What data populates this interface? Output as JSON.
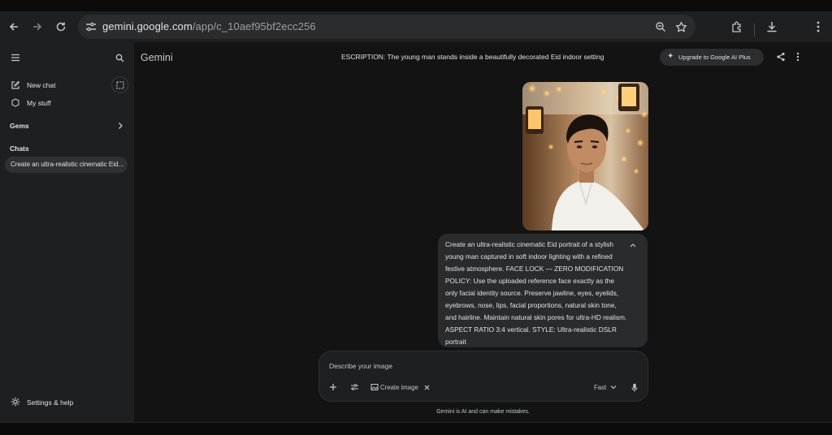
{
  "browser": {
    "url_host": "gemini.google.com",
    "url_path": "/app/c_10aef95bf2ecc256"
  },
  "sidebar": {
    "new_chat": "New chat",
    "my_stuff": "My stuff",
    "gems": "Gems",
    "chats_heading": "Chats",
    "chat_items": [
      "Create an ultra-realistic cinematic Eid..."
    ],
    "settings": "Settings & help"
  },
  "header": {
    "brand": "Gemini",
    "conversation_title": "ESCRIPTION: The young man stands inside a beautifully decorated Eid indoor setting",
    "upgrade_label": "Upgrade to Google AI Plus"
  },
  "message": {
    "text": "Create an ultra-realistic cinematic Eid portrait of a stylish young man captured in soft indoor lighting with a refined festive atmosphere. FACE LOCK — ZERO MODIFICATION POLICY: Use the uploaded reference face exactly as the only facial identity source. Preserve jawline, eyes, eyelids, eyebrows, nose, lips, facial proportions, natural skin tone, and hairline. Maintain natural skin pores for ultra-HD realism. ASPECT RATIO 3:4 vertical. STYLE: Ultra-realistic DSLR portrait"
  },
  "composer": {
    "placeholder": "Describe your image",
    "create_image_label": "Create image",
    "mode_label": "Fast"
  },
  "footer": {
    "disclaimer": "Gemini is AI and can make mistakes."
  },
  "colors": {
    "sidebar_bg": "#1e1f20",
    "main_bg": "#131314",
    "bubble_bg": "#2a2b2d",
    "text": "#e3e3e3"
  }
}
